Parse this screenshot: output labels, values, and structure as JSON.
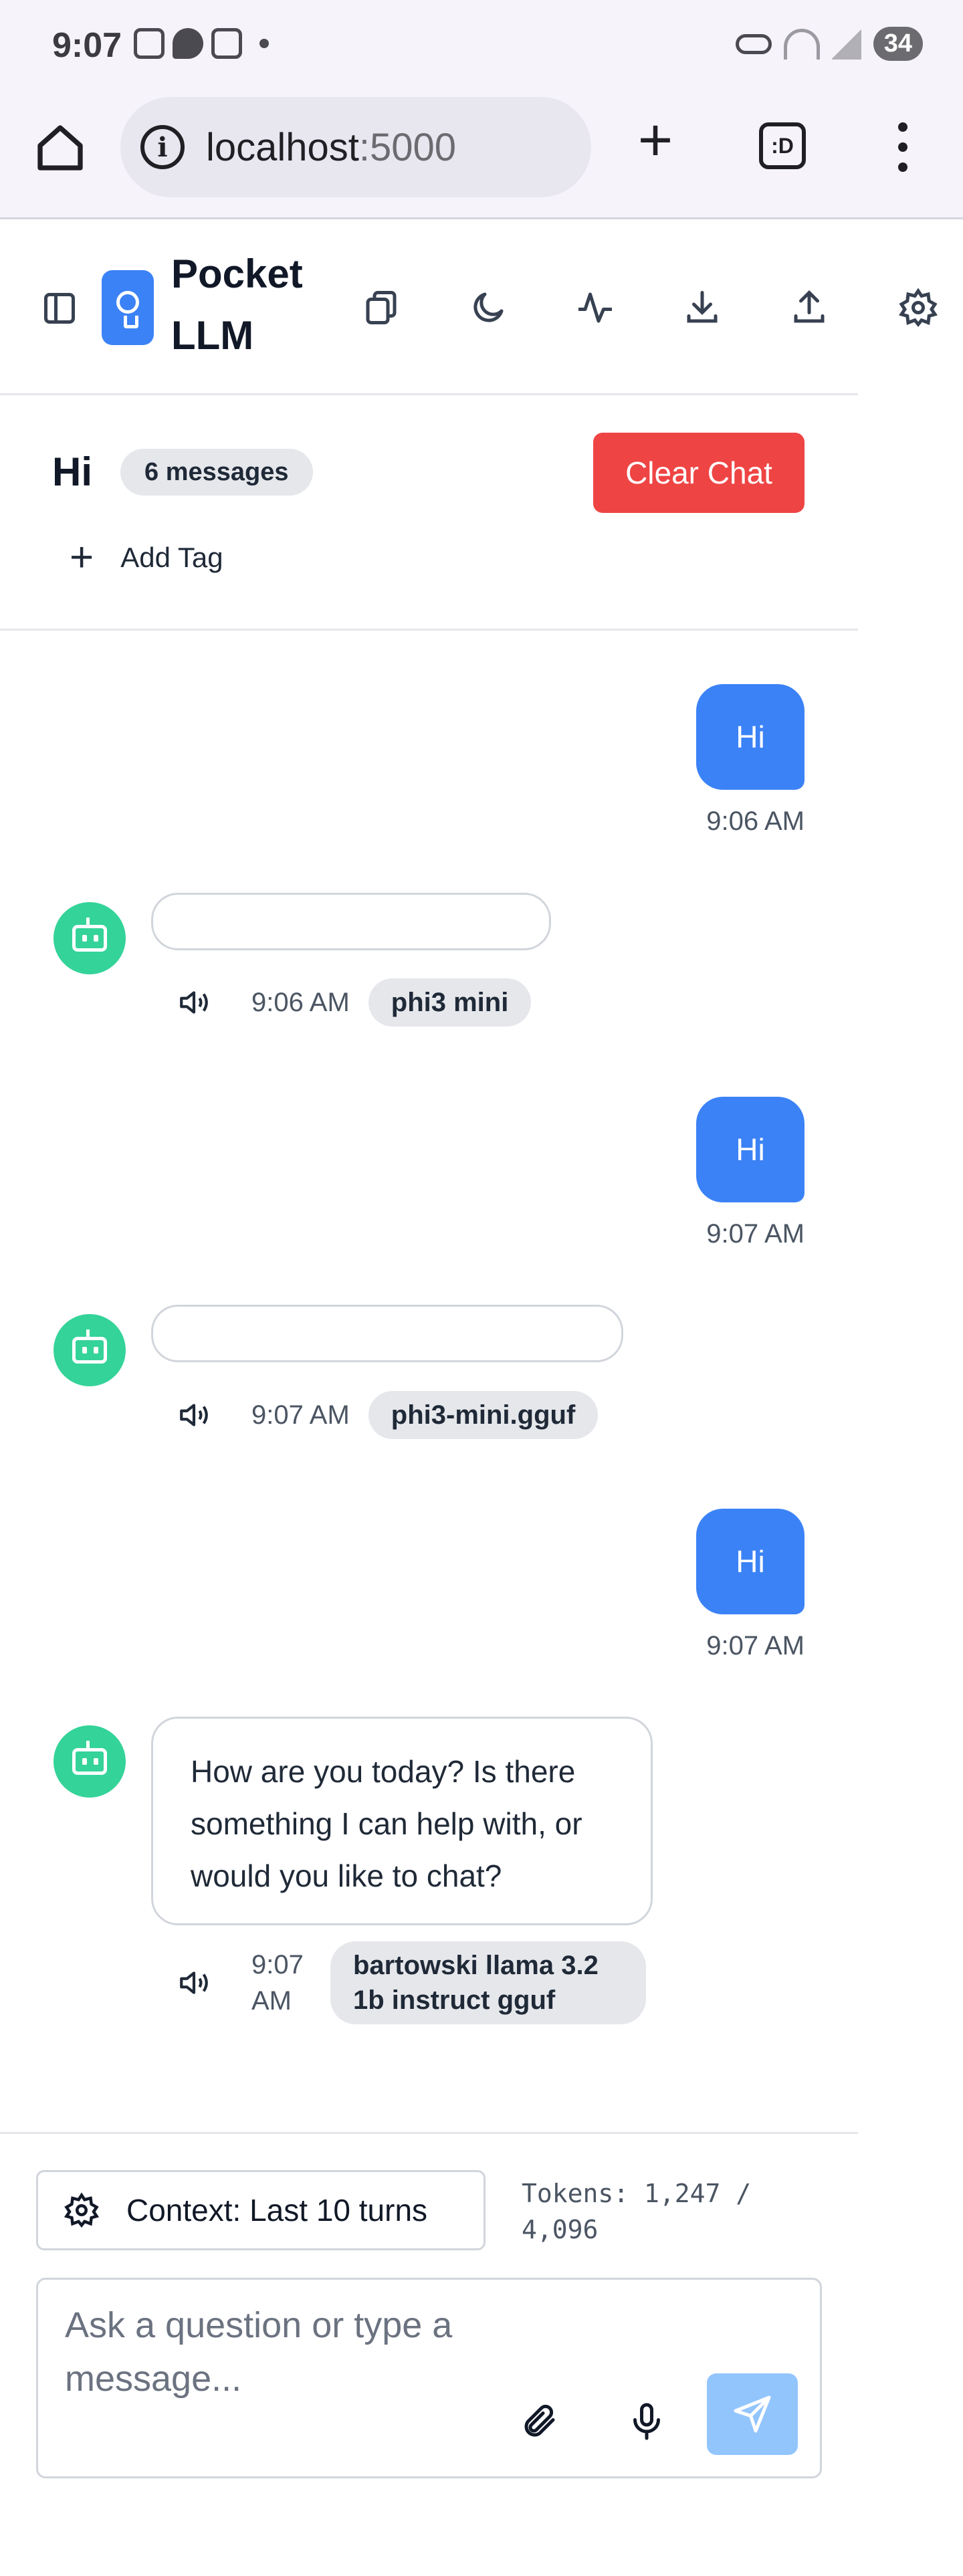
{
  "status_bar": {
    "time": "9:07",
    "battery": "34"
  },
  "browser": {
    "url_host": "localhost",
    "url_port": ":5000",
    "tabs_label": ":D"
  },
  "app": {
    "title": "Pocket LLM",
    "accent_color": "#3b82f6"
  },
  "chat": {
    "title": "Hi",
    "message_count": "6 messages",
    "clear_label": "Clear Chat",
    "add_tag_label": "Add Tag"
  },
  "messages": [
    {
      "role": "user",
      "text": "Hi",
      "time": "9:06 AM"
    },
    {
      "role": "assistant",
      "text": "",
      "time": "9:06 AM",
      "model": "phi3 mini"
    },
    {
      "role": "user",
      "text": "Hi",
      "time": "9:07 AM"
    },
    {
      "role": "assistant",
      "text": "",
      "time": "9:07 AM",
      "model": "phi3-mini.gguf"
    },
    {
      "role": "user",
      "text": "Hi",
      "time": "9:07 AM"
    },
    {
      "role": "assistant",
      "text": "How are you today? Is there something I can help with, or would you like to chat?",
      "time": "9:07 AM",
      "model": "bartowski llama 3.2 1b instruct gguf"
    }
  ],
  "composer": {
    "context_label": "Context: Last 10 turns",
    "tokens_label": "Tokens: 1,247 / 4,096",
    "placeholder": "Ask a question or type a message..."
  },
  "icons": {
    "header": [
      "sidebar-toggle-icon",
      "copy-icon",
      "moon-icon",
      "activity-icon",
      "download-icon",
      "upload-icon",
      "gear-icon"
    ]
  }
}
